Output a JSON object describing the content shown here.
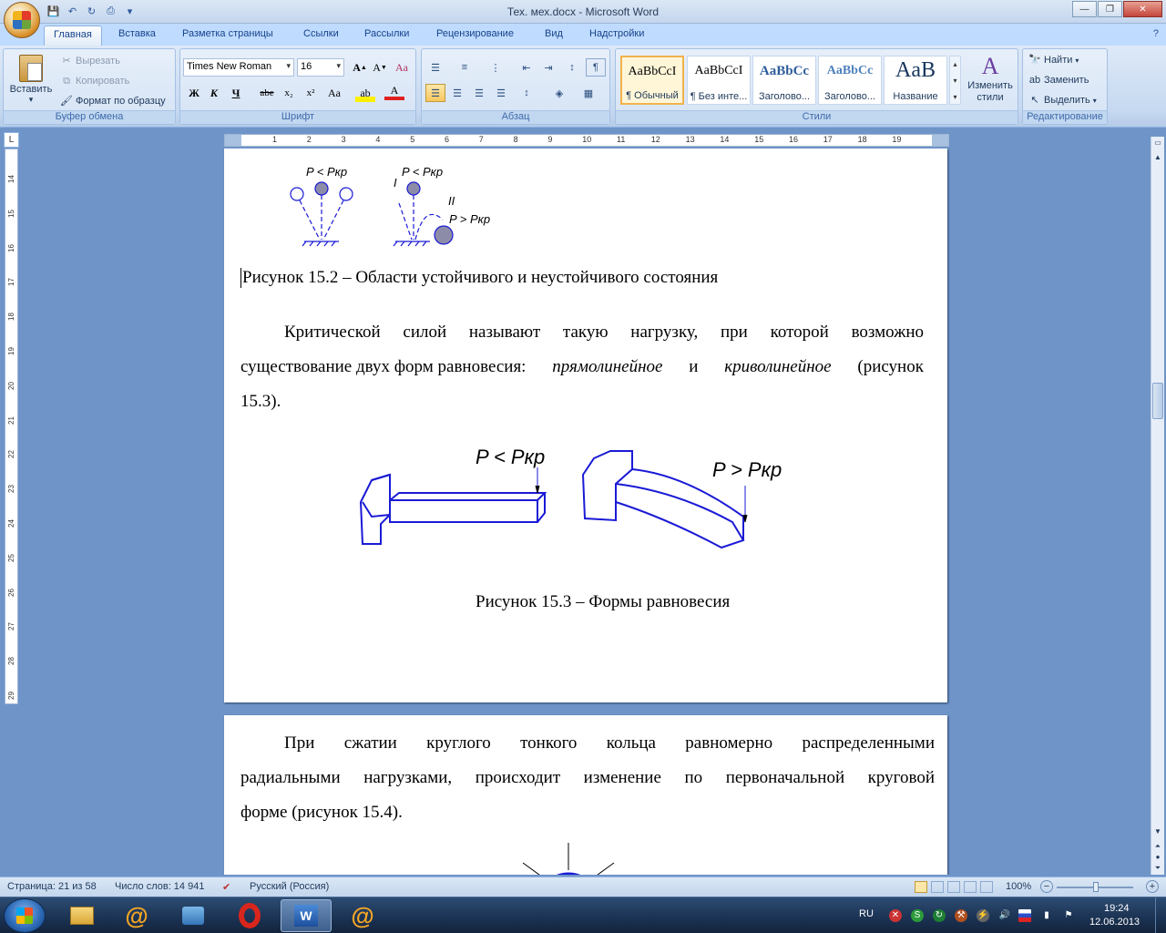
{
  "window": {
    "title": "Тех. мех.docx - Microsoft Word"
  },
  "tabs": [
    "Главная",
    "Вставка",
    "Разметка страницы",
    "Ссылки",
    "Рассылки",
    "Рецензирование",
    "Вид",
    "Надстройки"
  ],
  "clipboard": {
    "paste": "Вставить",
    "cut": "Вырезать",
    "copy": "Копировать",
    "format_painter": "Формат по образцу",
    "label": "Буфер обмена"
  },
  "font": {
    "name": "Times New Roman",
    "size": "16",
    "label": "Шрифт"
  },
  "paragraph": {
    "label": "Абзац"
  },
  "styles": {
    "label": "Стили",
    "items": [
      {
        "sample": "AaBbCcI",
        "name": "¶ Обычный"
      },
      {
        "sample": "AaBbCcI",
        "name": "¶ Без инте..."
      },
      {
        "sample": "AaBbCc",
        "name": "Заголово..."
      },
      {
        "sample": "AaBbCc",
        "name": "Заголово..."
      },
      {
        "sample": "AaB",
        "name": "Название"
      }
    ],
    "change": "Изменить стили"
  },
  "editing": {
    "find": "Найти",
    "replace": "Заменить",
    "select": "Выделить",
    "label": "Редактирование"
  },
  "document": {
    "fig152_label_a": "P < Pкр",
    "fig152_label_b": "P < Pкр",
    "fig152_label_c": "P > Pкр",
    "fig152_mark_i": "I",
    "fig152_mark_ii": "II",
    "caption_152": "Рисунок 15.2 – Области устойчивого и неустойчивого состояния",
    "para1_l1": "Критической силой называют такую нагрузку, при которой возможно",
    "para1_l2a": "существование двух форм равновесия:",
    "para1_l2b": "прямолинейное",
    "para1_l2c": "и",
    "para1_l2d": "криволинейное",
    "para1_l2e": "(рисунок",
    "para1_l3": "15.3).",
    "fig153_label_a": "P < Pкр",
    "fig153_label_b": "P > Pкр",
    "caption_153": "Рисунок 15.3 – Формы равновесия",
    "para2_l1": "При сжатии круглого тонкого кольца равномерно распределенными",
    "para2_l2": "радиальными нагрузками, происходит изменение по первоначальной круговой",
    "para2_l3": "форме (рисунок 15.4)."
  },
  "status": {
    "page": "Страница: 21 из 58",
    "words": "Число слов: 14 941",
    "language": "Русский (Россия)",
    "zoom": "100%"
  },
  "taskbar": {
    "lang": "RU",
    "time": "19:24",
    "date": "12.06.2013"
  },
  "ruler": {
    "h": [
      "1",
      "2",
      "3",
      "4",
      "5",
      "6",
      "7",
      "8",
      "9",
      "10",
      "11",
      "12",
      "13",
      "14",
      "15",
      "16",
      "17",
      "18",
      "19"
    ],
    "v": [
      "14",
      "15",
      "16",
      "17",
      "18",
      "19",
      "20",
      "21",
      "22",
      "23",
      "24",
      "25",
      "26",
      "27",
      "28",
      "29"
    ]
  }
}
